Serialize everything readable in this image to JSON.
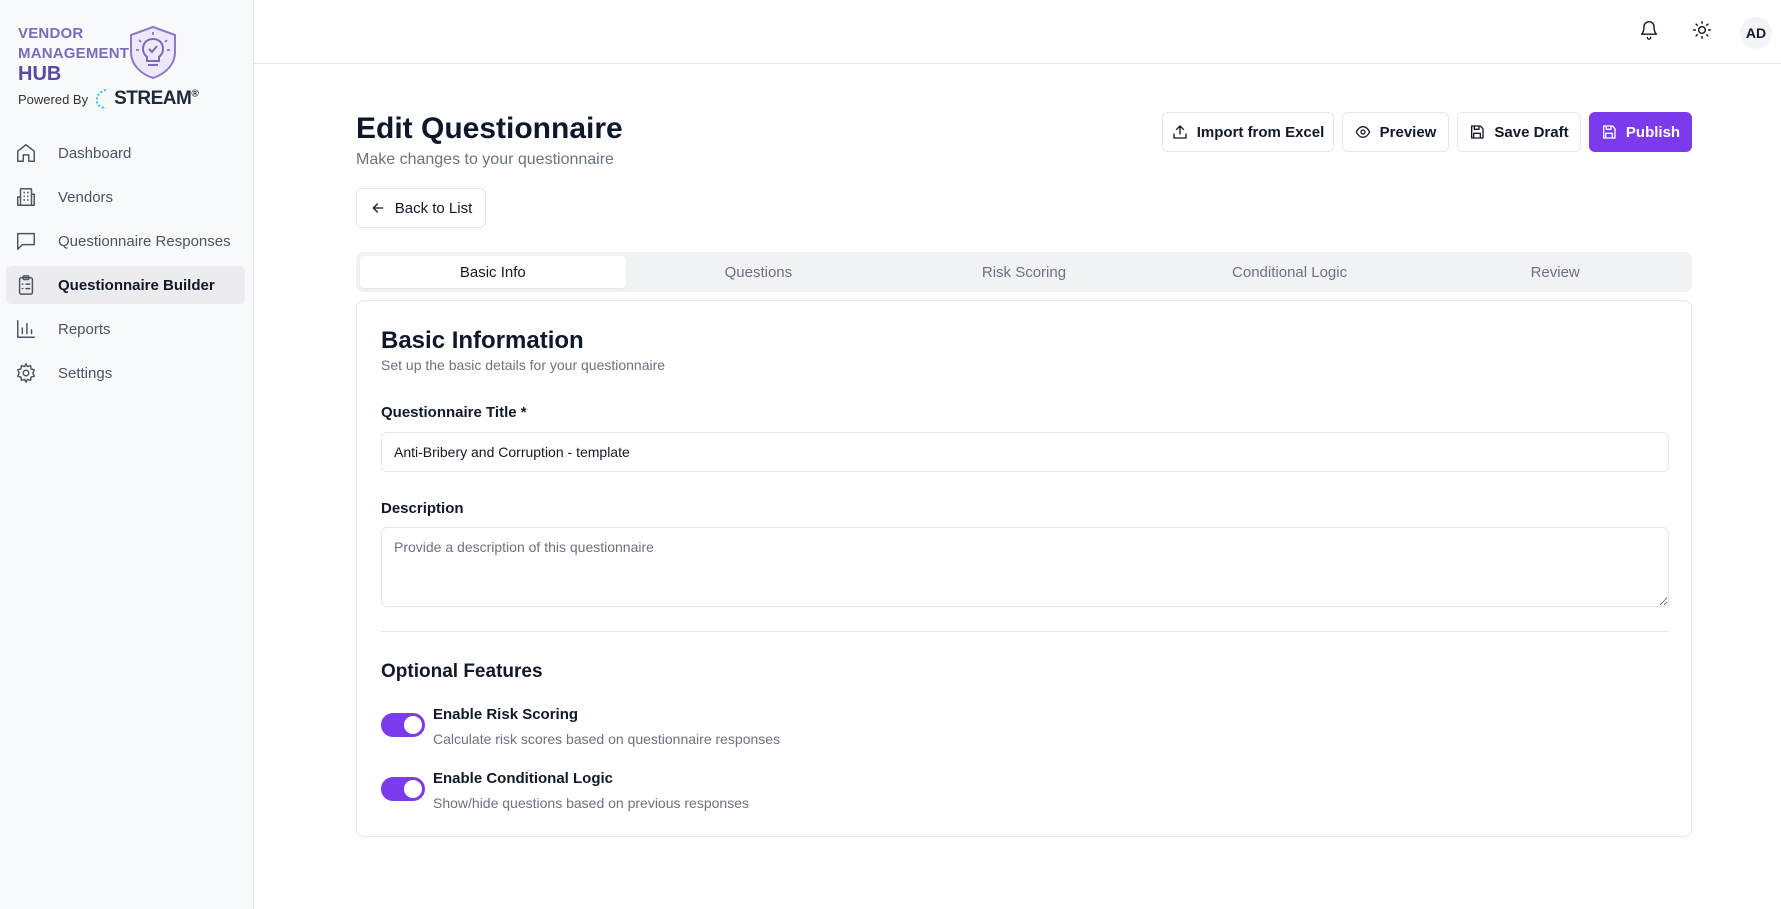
{
  "logo": {
    "line1": "VENDOR",
    "line2": "MANAGEMENT",
    "line3": "HUB",
    "powered_by": "Powered By",
    "stream": "STREAM",
    "reg": "®"
  },
  "sidebar": {
    "items": [
      {
        "label": "Dashboard",
        "icon": "home-icon"
      },
      {
        "label": "Vendors",
        "icon": "building-icon"
      },
      {
        "label": "Questionnaire Responses",
        "icon": "message-square-icon"
      },
      {
        "label": "Questionnaire Builder",
        "icon": "clipboard-icon",
        "active": true
      },
      {
        "label": "Reports",
        "icon": "bar-chart-icon"
      },
      {
        "label": "Settings",
        "icon": "gear-icon"
      }
    ]
  },
  "header": {
    "avatar": "AD"
  },
  "page": {
    "title": "Edit Questionnaire",
    "subtitle": "Make changes to your questionnaire",
    "back_label": "Back to List"
  },
  "actions": {
    "import_label": "Import from Excel",
    "preview_label": "Preview",
    "save_draft_label": "Save Draft",
    "publish_label": "Publish"
  },
  "tabs": [
    {
      "label": "Basic Info",
      "active": true
    },
    {
      "label": "Questions"
    },
    {
      "label": "Risk Scoring"
    },
    {
      "label": "Conditional Logic"
    },
    {
      "label": "Review"
    }
  ],
  "basic_info": {
    "title": "Basic Information",
    "subtitle": "Set up the basic details for your questionnaire",
    "title_field_label": "Questionnaire Title *",
    "title_field_value": "Anti-Bribery and Corruption - template",
    "description_label": "Description",
    "description_placeholder": "Provide a description of this questionnaire",
    "optional_title": "Optional Features",
    "toggles": [
      {
        "title": "Enable Risk Scoring",
        "desc": "Calculate risk scores based on questionnaire responses",
        "on": true
      },
      {
        "title": "Enable Conditional Logic",
        "desc": "Show/hide questions based on previous responses",
        "on": true
      }
    ]
  },
  "colors": {
    "accent": "#7c3aed",
    "logo": "#7c6bb8"
  }
}
